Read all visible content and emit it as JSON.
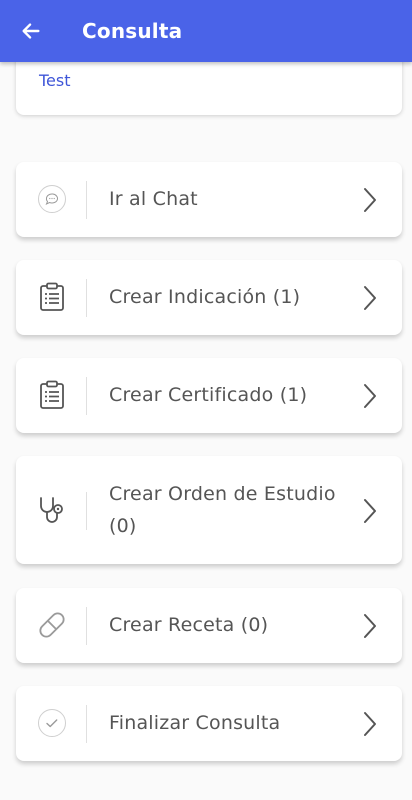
{
  "header": {
    "title": "Consulta",
    "back_icon": "arrow-left-icon",
    "color": "#4a63e8"
  },
  "top_card": {
    "partial_text": "·  ·",
    "link_text": "Test",
    "link_color": "#3f56d8"
  },
  "items": [
    {
      "label": "Ir al Chat",
      "icon": "chat-icon"
    },
    {
      "label": "Crear Indicación (1)",
      "icon": "clipboard-icon"
    },
    {
      "label": "Crear Certificado (1)",
      "icon": "clipboard-icon"
    },
    {
      "label": "Crear Orden de Estudio (0)",
      "icon": "stethoscope-icon"
    },
    {
      "label": "Crear Receta (0)",
      "icon": "pill-icon"
    },
    {
      "label": "Finalizar Consulta",
      "icon": "check-circle-icon"
    }
  ]
}
